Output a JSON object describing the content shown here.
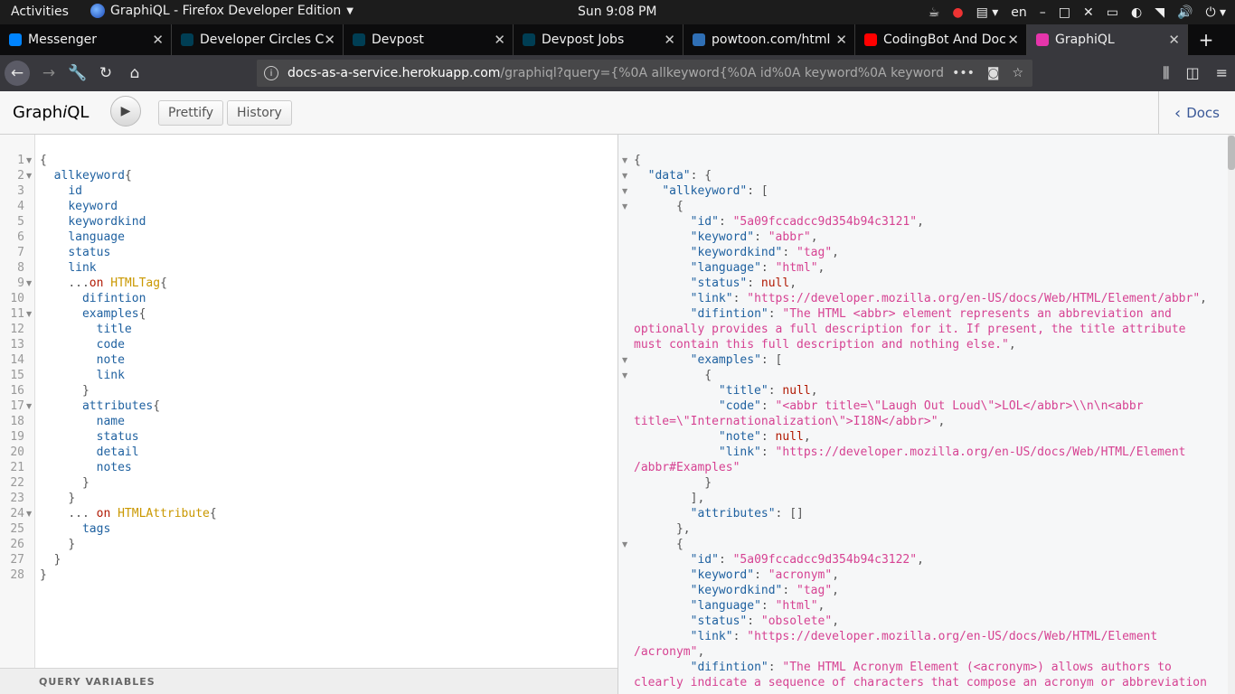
{
  "os": {
    "activities": "Activities",
    "app_title": "GraphiQL - Firefox Developer Edition",
    "clock": "Sun  9:08 PM",
    "lang": "en"
  },
  "tabs": [
    {
      "title": "Messenger",
      "icon": "messenger-icon",
      "color": "#0084ff"
    },
    {
      "title": "Developer Circles C",
      "icon": "devpost-icon",
      "color": "#003e54"
    },
    {
      "title": "Devpost",
      "icon": "devpost-icon",
      "color": "#003e54"
    },
    {
      "title": "Devpost Jobs",
      "icon": "devpost-icon",
      "color": "#003e54"
    },
    {
      "title": "powtoon.com/html",
      "icon": "powtoon-icon",
      "color": "#2f6fb5"
    },
    {
      "title": "CodingBot And Doc",
      "icon": "youtube-icon",
      "color": "#ff0000"
    },
    {
      "title": "GraphiQL",
      "icon": "graphql-icon",
      "color": "#e535ab"
    }
  ],
  "url": {
    "host": "docs-as-a-service.herokuapp.com",
    "path": "/graphiql?query={%0A  allkeyword{%0A    id%0A    keyword%0A    keyword"
  },
  "toolbar": {
    "logo_a": "Graph",
    "logo_b": "i",
    "logo_c": "QL",
    "prettify": "Prettify",
    "history": "History",
    "docs": "Docs"
  },
  "editor": {
    "query_variables_label": "QUERY VARIABLES",
    "lines": [
      {
        "n": "1",
        "fold": true,
        "indent": "",
        "text": "{"
      },
      {
        "n": "2",
        "fold": true,
        "indent": "  ",
        "text": "allkeyword{"
      },
      {
        "n": "3",
        "fold": false,
        "indent": "    ",
        "text": "id"
      },
      {
        "n": "4",
        "fold": false,
        "indent": "    ",
        "text": "keyword"
      },
      {
        "n": "5",
        "fold": false,
        "indent": "    ",
        "text": "keywordkind"
      },
      {
        "n": "6",
        "fold": false,
        "indent": "    ",
        "text": "language"
      },
      {
        "n": "7",
        "fold": false,
        "indent": "    ",
        "text": "status"
      },
      {
        "n": "8",
        "fold": false,
        "indent": "    ",
        "text": "link"
      },
      {
        "n": "9",
        "fold": true,
        "indent": "    ",
        "text": "...on HTMLTag{"
      },
      {
        "n": "10",
        "fold": false,
        "indent": "      ",
        "text": "difintion"
      },
      {
        "n": "11",
        "fold": true,
        "indent": "      ",
        "text": "examples{"
      },
      {
        "n": "12",
        "fold": false,
        "indent": "        ",
        "text": "title"
      },
      {
        "n": "13",
        "fold": false,
        "indent": "        ",
        "text": "code"
      },
      {
        "n": "14",
        "fold": false,
        "indent": "        ",
        "text": "note"
      },
      {
        "n": "15",
        "fold": false,
        "indent": "        ",
        "text": "link"
      },
      {
        "n": "16",
        "fold": false,
        "indent": "      ",
        "text": "}"
      },
      {
        "n": "17",
        "fold": true,
        "indent": "      ",
        "text": "attributes{"
      },
      {
        "n": "18",
        "fold": false,
        "indent": "        ",
        "text": "name"
      },
      {
        "n": "19",
        "fold": false,
        "indent": "        ",
        "text": "status"
      },
      {
        "n": "20",
        "fold": false,
        "indent": "        ",
        "text": "detail"
      },
      {
        "n": "21",
        "fold": false,
        "indent": "        ",
        "text": "notes"
      },
      {
        "n": "22",
        "fold": false,
        "indent": "      ",
        "text": "}"
      },
      {
        "n": "23",
        "fold": false,
        "indent": "    ",
        "text": "}"
      },
      {
        "n": "24",
        "fold": true,
        "indent": "    ",
        "text": "... on HTMLAttribute{"
      },
      {
        "n": "25",
        "fold": false,
        "indent": "      ",
        "text": "tags"
      },
      {
        "n": "26",
        "fold": false,
        "indent": "    ",
        "text": "}"
      },
      {
        "n": "27",
        "fold": false,
        "indent": "  ",
        "text": "}"
      },
      {
        "n": "28",
        "fold": false,
        "indent": "",
        "text": "}"
      }
    ]
  },
  "result": {
    "lines": [
      {
        "fold": true,
        "text": "{"
      },
      {
        "fold": true,
        "text": "  \"data\": {"
      },
      {
        "fold": true,
        "text": "    \"allkeyword\": ["
      },
      {
        "fold": true,
        "text": "      {"
      },
      {
        "fold": false,
        "text": "        \"id\": \"5a09fccadcc9d354b94c3121\","
      },
      {
        "fold": false,
        "text": "        \"keyword\": \"abbr\","
      },
      {
        "fold": false,
        "text": "        \"keywordkind\": \"tag\","
      },
      {
        "fold": false,
        "text": "        \"language\": \"html\","
      },
      {
        "fold": false,
        "text": "        \"status\": null,"
      },
      {
        "fold": false,
        "text": "        \"link\": \"https://developer.mozilla.org/en-US/docs/Web/HTML/Element/abbr\","
      },
      {
        "fold": false,
        "text": "        \"difintion\": \"The HTML <abbr> element represents an abbreviation and"
      },
      {
        "fold": false,
        "text": "optionally provides a full description for it. If present, the title attribute"
      },
      {
        "fold": false,
        "text": "must contain this full description and nothing else.\","
      },
      {
        "fold": true,
        "text": "        \"examples\": ["
      },
      {
        "fold": true,
        "text": "          {"
      },
      {
        "fold": false,
        "text": "            \"title\": null,"
      },
      {
        "fold": false,
        "text": "            \"code\": \"<abbr title=\\\"Laugh Out Loud\\\">LOL</abbr>\\\\n\\n<abbr"
      },
      {
        "fold": false,
        "text": "title=\\\"Internationalization\\\">I18N</abbr>\","
      },
      {
        "fold": false,
        "text": "            \"note\": null,"
      },
      {
        "fold": false,
        "text": "            \"link\": \"https://developer.mozilla.org/en-US/docs/Web/HTML/Element"
      },
      {
        "fold": false,
        "text": "/abbr#Examples\""
      },
      {
        "fold": false,
        "text": "          }"
      },
      {
        "fold": false,
        "text": "        ],"
      },
      {
        "fold": false,
        "text": "        \"attributes\": []"
      },
      {
        "fold": false,
        "text": "      },"
      },
      {
        "fold": true,
        "text": "      {"
      },
      {
        "fold": false,
        "text": "        \"id\": \"5a09fccadcc9d354b94c3122\","
      },
      {
        "fold": false,
        "text": "        \"keyword\": \"acronym\","
      },
      {
        "fold": false,
        "text": "        \"keywordkind\": \"tag\","
      },
      {
        "fold": false,
        "text": "        \"language\": \"html\","
      },
      {
        "fold": false,
        "text": "        \"status\": \"obsolete\","
      },
      {
        "fold": false,
        "text": "        \"link\": \"https://developer.mozilla.org/en-US/docs/Web/HTML/Element"
      },
      {
        "fold": false,
        "text": "/acronym\","
      },
      {
        "fold": false,
        "text": "        \"difintion\": \"The HTML Acronym Element (<acronym>) allows authors to"
      },
      {
        "fold": false,
        "text": "clearly indicate a sequence of characters that compose an acronym or abbreviation"
      }
    ]
  }
}
